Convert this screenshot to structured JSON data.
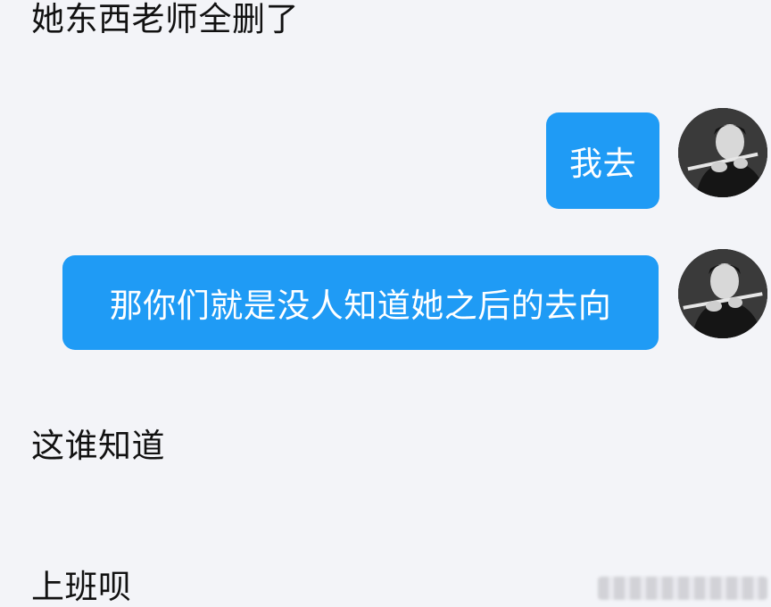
{
  "messages": [
    {
      "id": "msg-1",
      "direction": "incoming",
      "text": "她东西老师全删了"
    },
    {
      "id": "msg-2",
      "direction": "outgoing",
      "text": "我去"
    },
    {
      "id": "msg-3",
      "direction": "outgoing",
      "text": "那你们就是没人知道她之后的去向"
    },
    {
      "id": "msg-4",
      "direction": "incoming",
      "text": "这谁知道"
    },
    {
      "id": "msg-5",
      "direction": "incoming",
      "text": "上班呗"
    }
  ],
  "colors": {
    "background": "#f3f4f8",
    "outgoing_bubble": "#1f9bf5",
    "outgoing_text": "#ffffff",
    "incoming_text": "#111111"
  },
  "icons": {
    "avatar": "user-avatar-photo"
  }
}
